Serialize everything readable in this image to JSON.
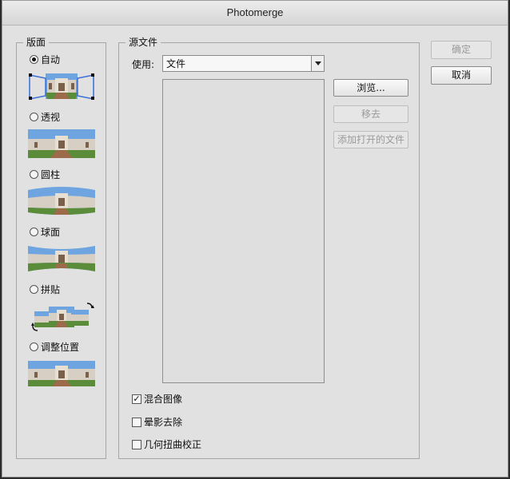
{
  "window": {
    "title": "Photomerge"
  },
  "layout": {
    "legend": "版面",
    "options": [
      {
        "label": "自动",
        "selected": true
      },
      {
        "label": "透视",
        "selected": false
      },
      {
        "label": "圆柱",
        "selected": false
      },
      {
        "label": "球面",
        "selected": false
      },
      {
        "label": "拼贴",
        "selected": false
      },
      {
        "label": "调整位置",
        "selected": false
      }
    ]
  },
  "source": {
    "legend": "源文件",
    "use_label": "使用:",
    "use_value": "文件",
    "browse_label": "浏览...",
    "remove_label": "移去",
    "add_open_label": "添加打开的文件"
  },
  "options": {
    "blend_label": "混合图像",
    "blend_checked": true,
    "vignette_label": "晕影去除",
    "vignette_checked": false,
    "distortion_label": "几何扭曲校正",
    "distortion_checked": false
  },
  "actions": {
    "ok_label": "确定",
    "cancel_label": "取消"
  },
  "colors": {
    "dialog_bg": "#e2e1e2",
    "sky": "#6ea4e0",
    "building": "#d8cfc4",
    "grass": "#5a8c3a",
    "selection_frame": "#3b6fd8"
  }
}
